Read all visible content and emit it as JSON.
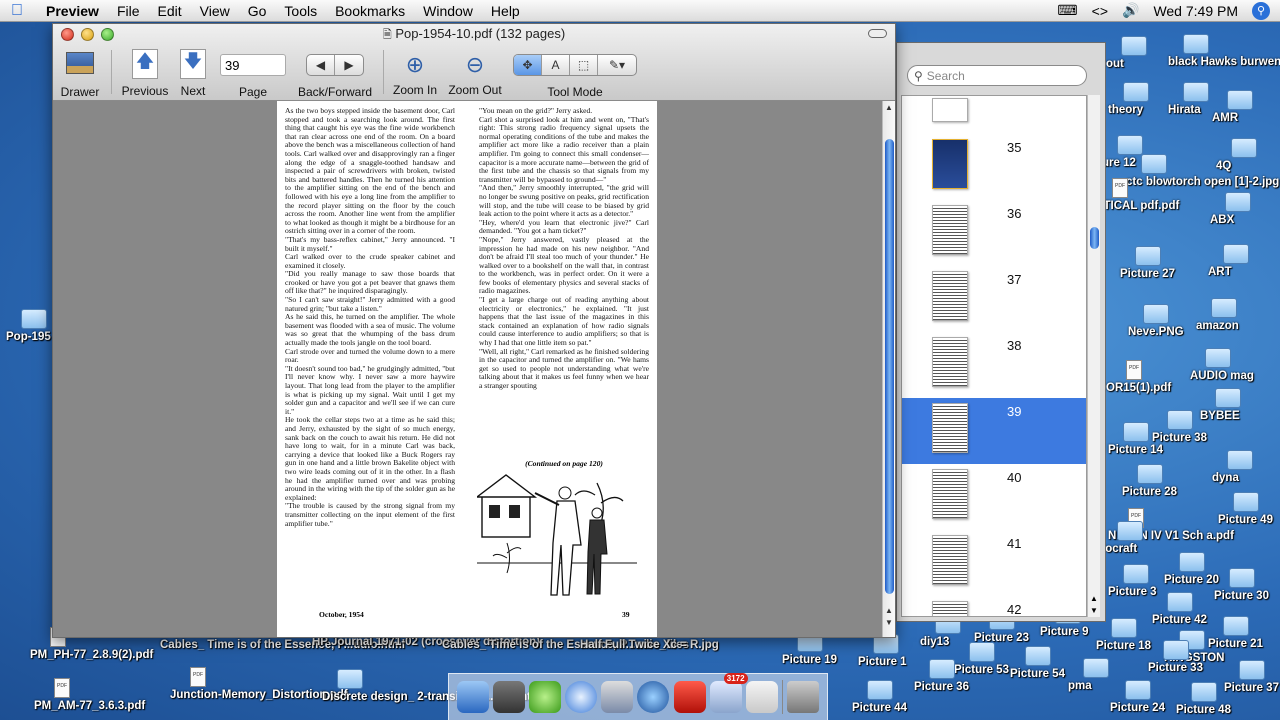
{
  "menubar": {
    "app": "Preview",
    "items": [
      "File",
      "Edit",
      "View",
      "Go",
      "Tools",
      "Bookmarks",
      "Window",
      "Help"
    ],
    "clock": "Wed 7:49 PM"
  },
  "window": {
    "title": "Pop-1954-10.pdf (132 pages)"
  },
  "toolbar": {
    "drawer": "Drawer",
    "previous": "Previous",
    "next": "Next",
    "page_value": "39",
    "page": "Page",
    "back_forward": "Back/Forward",
    "zoom_in": "Zoom In",
    "zoom_out": "Zoom Out",
    "tool_mode": "Tool Mode",
    "tool_text_glyph": "A"
  },
  "drawer": {
    "search_placeholder": "Search",
    "pages": [
      "35",
      "36",
      "37",
      "38",
      "39",
      "40",
      "41",
      "42"
    ],
    "selected": "39",
    "scroll_fraction": 0.3
  },
  "document": {
    "col1": "As the two boys stepped inside the basement door, Carl stopped and took a searching look around. The first thing that caught his eye was the fine wide workbench that ran clear across one end of the room. On a board above the bench was a miscellaneous collection of hand tools. Carl walked over and disapprovingly ran a finger along the edge of a snaggle-toothed handsaw and inspected a pair of screwdrivers with broken, twisted bits and battered handles. Then he turned his attention to the amplifier sitting on the end of the bench and followed with his eye a long line from the amplifier to the record player sitting on the floor by the couch across the room. Another line went from the amplifier to what looked as though it might be a birdhouse for an ostrich sitting over in a corner of the room.\n\"That's my bass-reflex cabinet,\" Jerry announced. \"I built it myself.\"\nCarl walked over to the crude speaker cabinet and examined it closely.\n\"Did you really manage to saw those boards that crooked or have you got a pet beaver that gnaws them off like that?\" he inquired disparagingly.\n\"So I can't saw straight!\" Jerry admitted with a good natured grin; \"but take a listen.\"\nAs he said this, he turned on the amplifier. The whole basement was flooded with a sea of music. The volume was so great that the whumping of the bass drum actually made the tools jangle on the tool board.\nCarl strode over and turned the volume down to a mere roar.\n\"It doesn't sound too bad,\" he grudgingly admitted, \"but I'll never know why. I never saw a more haywire layout. That long lead from the player to the amplifier is what is picking up my signal. Wait until I get my solder gun and a capacitor and we'll see if we can cure it.\"\nHe took the cellar steps two at a time as he said this; and Jerry, exhausted by the sight of so much energy, sank back on the couch to await his return. He did not have long to wait, for in a minute Carl was back, carrying a device that looked like a Buck Rogers ray gun in one hand and a little brown Bakelite object with two wire leads coming out of it in the other. In a flash he had the amplifier turned over and was probing around in the wiring with the tip of the solder gun as he explained:\n\"The trouble is caused by the strong signal from my transmitter collecting on the input element of the first amplifier tube.\"",
    "col2": "\"You mean on the grid?\" Jerry asked.\nCarl shot a surprised look at him and went on, \"That's right: This strong radio frequency signal upsets the normal operating conditions of the tube and makes the amplifier act more like a radio receiver than a plain amplifier. I'm going to connect this small condenser—capacitor is a more accurate name—between the grid of the first tube and the chassis so that signals from my transmitter will be bypassed to ground—\"\n\"And then,\" Jerry smoothly interrupted, \"the grid will no longer be swung positive on peaks, grid rectification will stop, and the tube will cease to be biased by grid leak action to the point where it acts as a detector.\"\n\"Hey, where'd you learn that electronic jive?\" Carl demanded. \"You got a ham ticket?\"\n\"Nope,\" Jerry answered, vastly pleased at the impression he had made on his new neighbor. \"And don't be afraid I'll steal too much of your thunder.\" He walked over to a bookshelf on the wall that, in contrast to the workbench, was in perfect order. On it were a few books of elementary physics and several stacks of radio magazines.\n\"I get a large charge out of reading anything about electricity or electronics,\" he explained. \"It just happens that the last issue of the magazines in this stack contained an explanation of how radio signals could cause interference to audio amplifiers; so that is why I had that one little item so pat.\"\n\"Well, all right,\" Carl remarked as he finished soldering in the capacitor and turned the amplifier on. \"We hams get so used to people not understanding what we're talking about that it makes us feel funny when we hear a stranger spouting",
    "continued": "(Continued on page 120)",
    "footer_left": "October, 1954",
    "footer_right": "39"
  },
  "desktop_icons": [
    "black Hawks burwen",
    "theory",
    "Hirata",
    "AMR",
    "4Q",
    "ctc blowtorch open [1]-2.jpg",
    "ABX",
    "Picture 27",
    "ART",
    "Neve.PNG",
    "amazon",
    "AUDIO mag",
    "BYBEE",
    "Picture 38",
    "Picture 14",
    "dyna",
    "Picture 28",
    "Picture 49",
    "NEXEN IV V1 Sch a.pdf",
    "Picture 3",
    "Picture 20",
    "Picture 30",
    "Picture 42",
    "Picture 18",
    "Picture 21",
    "KINGSTON",
    "Picture 33",
    "Picture 9",
    "Picture 23",
    "diy13",
    "Picture 54",
    "Picture 53",
    "Picture 1",
    "Picture 19",
    "Picture 36",
    "Picture 44",
    "Picture 24",
    "Picture 37",
    "Picture 48",
    "pma",
    "PM_PH-77_2.8.9(2).pdf",
    "Cables_ Time is of the Essence, P...udio.html",
    "HP Journal 1971-02 (crossover distortion)",
    "Cables_ Time is of the Essence, P...udio_files",
    "Half Full Twice Xc = R.jpg",
    "PM_AM-77_3.6.3.pdf",
    "Junction-Memory_Distortion.pdf",
    "Discrete design_ 2-transistor ...amp.html",
    "Pop-195",
    "out",
    "ure 12",
    "RITICAL pdf.pdf",
    "OR15(1).pdf",
    "iocraft"
  ],
  "dock_badge": "3172"
}
